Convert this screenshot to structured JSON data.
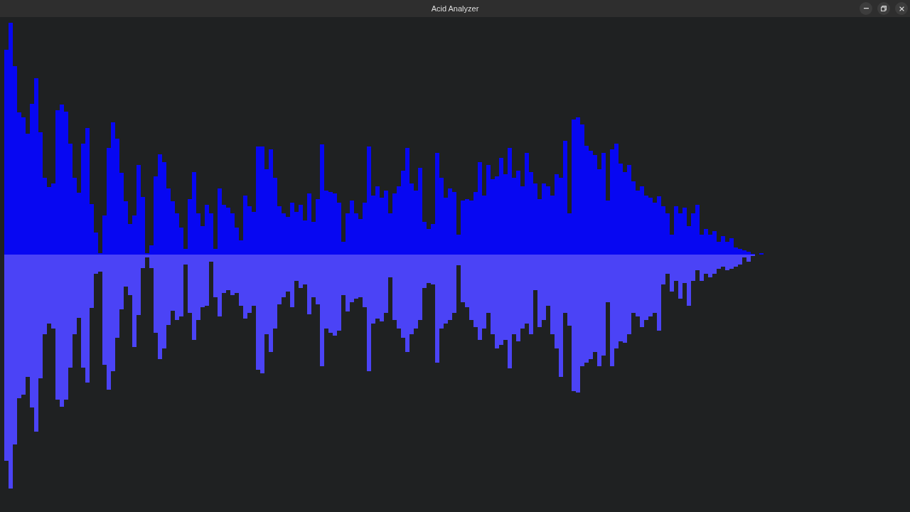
{
  "window": {
    "title": "Acid Analyzer"
  }
}
